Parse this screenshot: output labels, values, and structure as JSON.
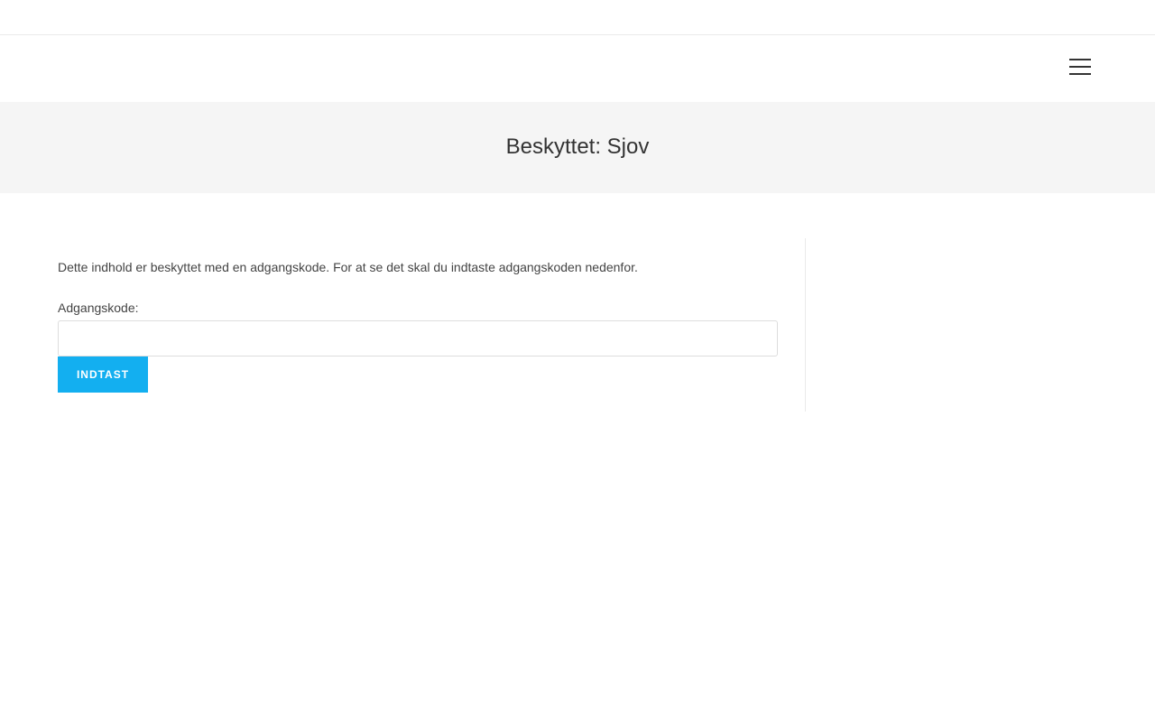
{
  "header": {
    "menu_icon": "hamburger-menu-icon"
  },
  "page_header": {
    "title": "Beskyttet: Sjov"
  },
  "content": {
    "intro": "Dette indhold er beskyttet med en adgangskode. For at se det skal du indtaste adgangskoden nedenfor.",
    "password_label": "Adgangskode:",
    "password_value": "",
    "submit_label": "INDTAST"
  },
  "colors": {
    "accent": "#13aff0",
    "page_header_bg": "#f5f5f5",
    "text": "#333333"
  }
}
